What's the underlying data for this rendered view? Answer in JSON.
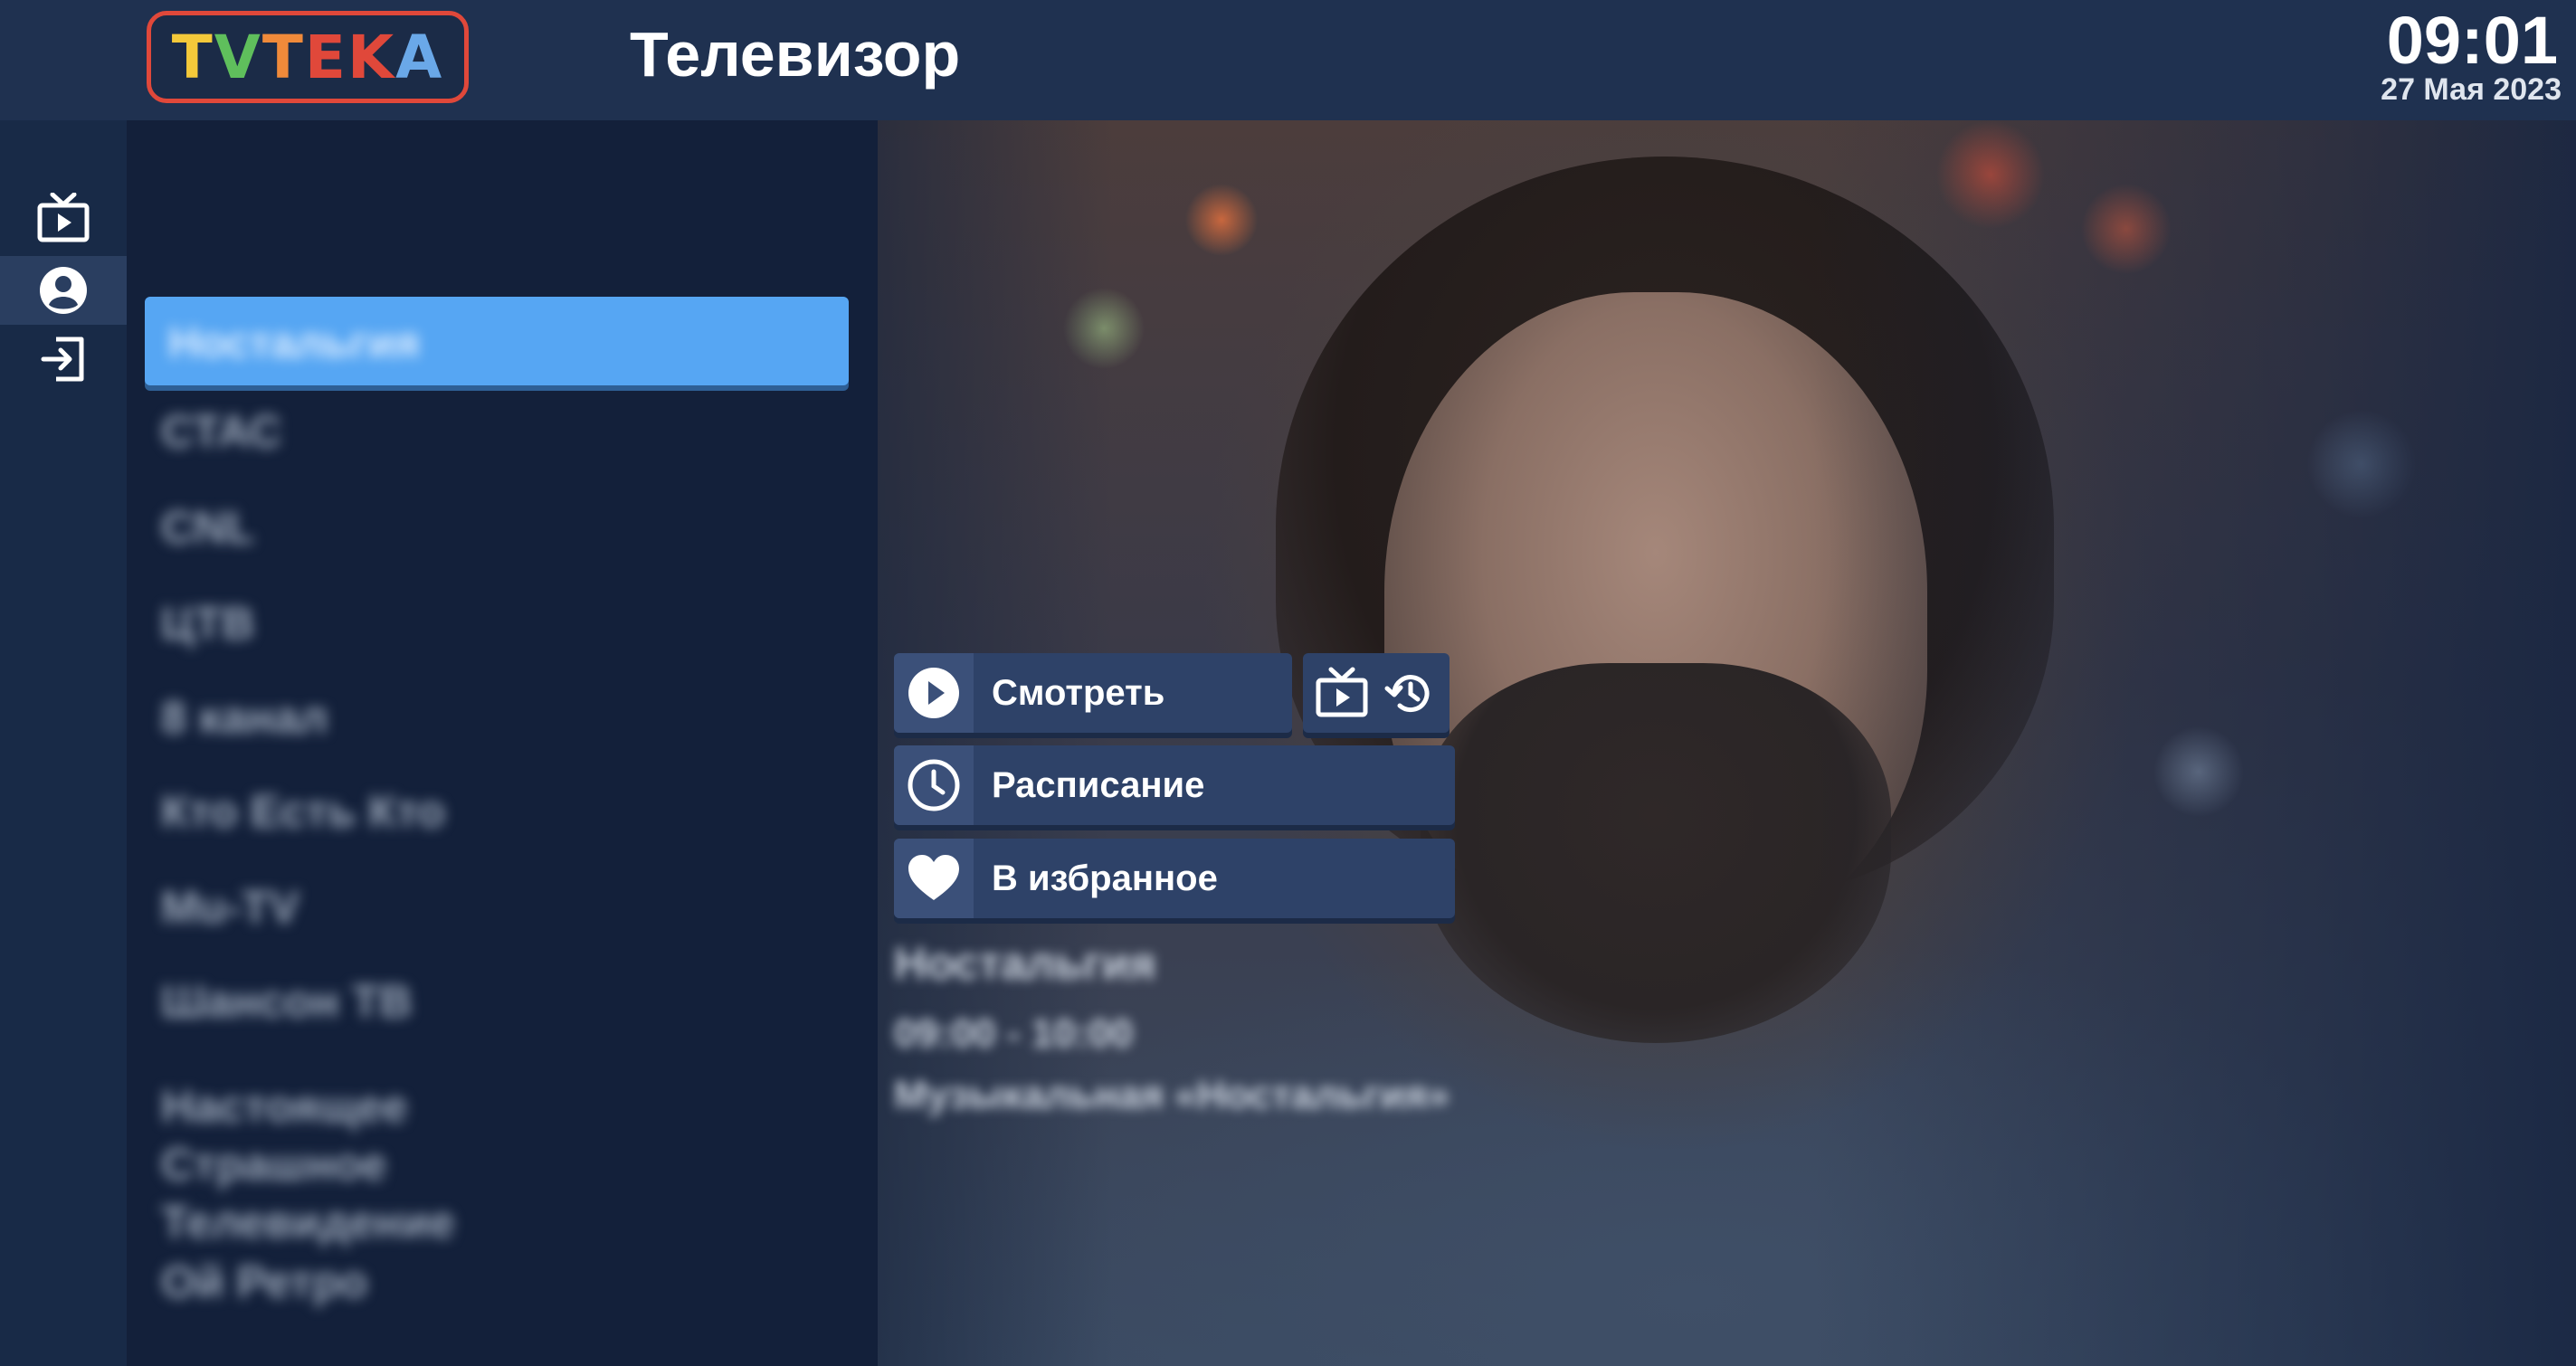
{
  "header": {
    "logo_letters": [
      "T",
      "V",
      "T",
      "E",
      "K",
      "A"
    ],
    "logo_colors": [
      "#f4c93a",
      "#5fbf5c",
      "#f08a3a",
      "#e0483a",
      "#e0483a",
      "#6aa8e8"
    ],
    "title": "Телевизор",
    "time": "09:01",
    "date": "27 Мая 2023"
  },
  "rail": {
    "items": [
      {
        "name": "tv-icon"
      },
      {
        "name": "profile-icon"
      },
      {
        "name": "logout-icon"
      }
    ]
  },
  "channels": {
    "selected": "Ностальгия",
    "items": [
      "СТАС",
      "CNL",
      "ЦТВ",
      "8 канал",
      "Кто Есть Кто",
      "Mu-TV",
      "Шансон ТВ",
      "Настоящее\nСтрашное\nТелевидение",
      "Ой Ретро"
    ]
  },
  "actions": {
    "watch_label": "Смотреть",
    "schedule_label": "Расписание",
    "favorite_label": "В избранное"
  },
  "program": {
    "channel": "Ностальгия",
    "time": "09:00 - 10:00",
    "title": "Музыкальная «Ностальгия»"
  },
  "colors": {
    "header_bg": "#1f3150",
    "accent": "#56a6f3",
    "button_bg": "#2e4268"
  }
}
